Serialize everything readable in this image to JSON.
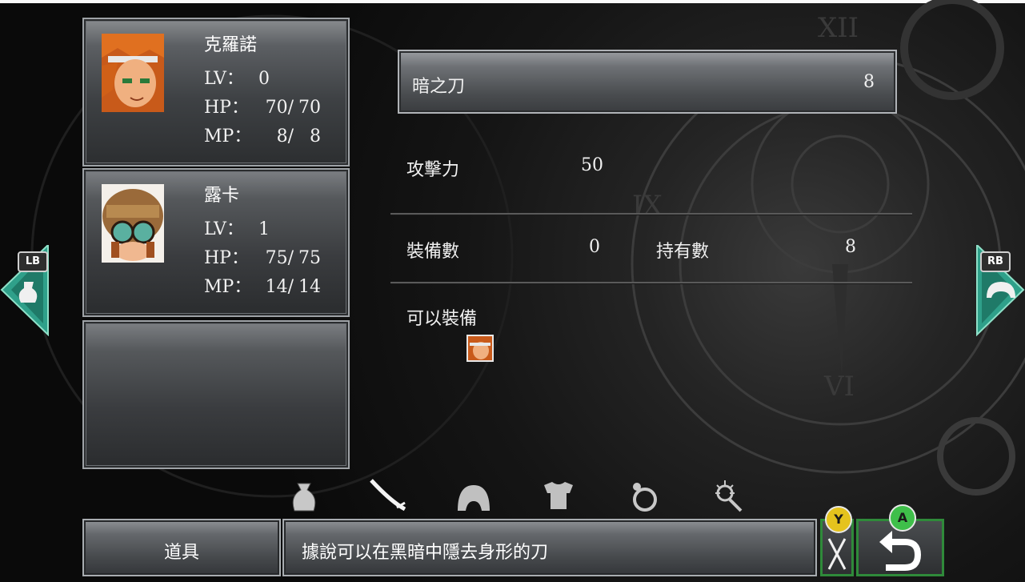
{
  "party": [
    {
      "name": "克羅諾",
      "lv_label": "LV：",
      "lv": "0",
      "hp_label": "HP：",
      "hp": "70/",
      "hp_max": "70",
      "mp_label": "MP：",
      "mp": "8/",
      "mp_max": "8"
    },
    {
      "name": "露卡",
      "lv_label": "LV：",
      "lv": "1",
      "hp_label": "HP：",
      "hp": "75/",
      "hp_max": "75",
      "mp_label": "MP：",
      "mp": "14/",
      "mp_max": "14"
    }
  ],
  "item": {
    "name": "暗之刀",
    "quantity": "8"
  },
  "stats": {
    "attack_label": "攻擊力",
    "attack_value": "50",
    "equipped_label": "裝備數",
    "equipped_value": "0",
    "owned_label": "持有數",
    "owned_value": "8",
    "equippable_label": "可以裝備"
  },
  "buttons": {
    "lb": "LB",
    "rb": "RB",
    "items_tab": "道具",
    "description": "據說可以在黑暗中隱去身形的刀",
    "y_badge": "Y",
    "a_badge": "A"
  },
  "categories": [
    "bag-icon",
    "sword-icon",
    "helmet-icon",
    "armor-icon",
    "ring-icon",
    "accessory-icon"
  ],
  "colors": {
    "accent_green": "#2f8a3a",
    "teal_arrow": "#2fa08a",
    "y_badge": "#e5c31d",
    "a_badge": "#3fbf4a"
  }
}
